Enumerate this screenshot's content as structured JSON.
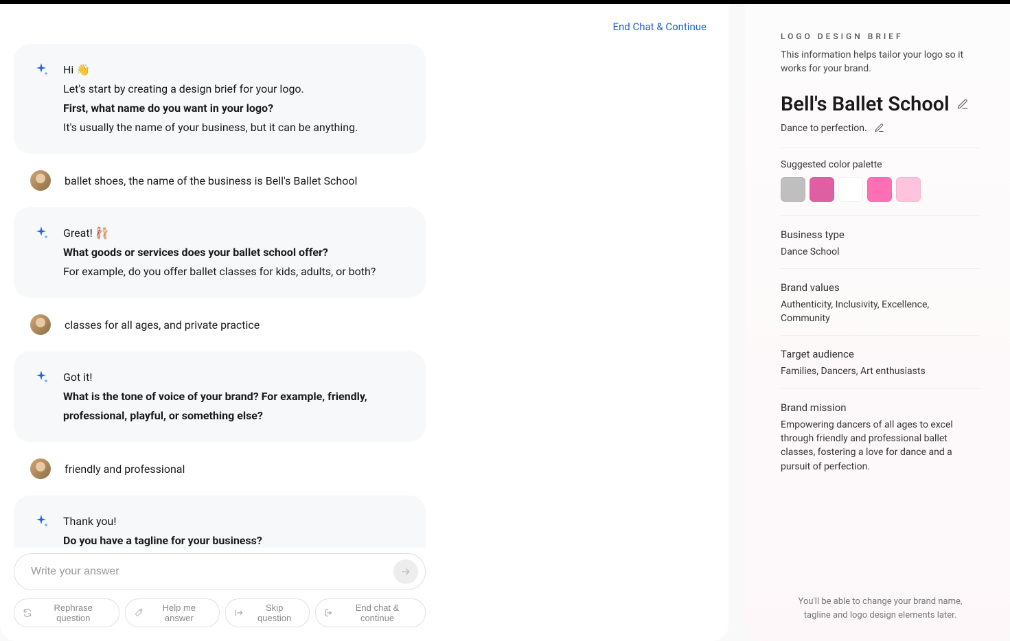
{
  "header": {
    "end_chat_label": "End Chat & Continue"
  },
  "chat": {
    "messages": [
      {
        "role": "bot",
        "lines": [
          {
            "text": "Hi 👋",
            "bold": false
          },
          {
            "text": "Let's start by creating a design brief for your logo.",
            "bold": false
          },
          {
            "text": "First, what name do you want in your logo?",
            "bold": true
          },
          {
            "text": "It's usually the name of your business, but it can be anything.",
            "bold": false
          }
        ]
      },
      {
        "role": "user",
        "text": "ballet shoes, the name of the business is Bell's Ballet School"
      },
      {
        "role": "bot",
        "lines": [
          {
            "text": "Great! 🩰",
            "bold": false
          },
          {
            "text": "What goods or services does your ballet school offer?",
            "bold": true
          },
          {
            "text": "For example, do you offer ballet classes for kids, adults, or both?",
            "bold": false
          }
        ]
      },
      {
        "role": "user",
        "text": "classes for all ages, and private practice"
      },
      {
        "role": "bot",
        "lines": [
          {
            "text": "Got it!",
            "bold": false
          },
          {
            "text": "What is the tone of voice of your brand? For example, friendly, professional, playful, or something else?",
            "bold": true
          }
        ]
      },
      {
        "role": "user",
        "text": "friendly and professional"
      },
      {
        "role": "bot",
        "lines": [
          {
            "text": "Thank you!",
            "bold": false
          },
          {
            "text": "Do you have a tagline for your business?",
            "bold": true
          }
        ]
      }
    ],
    "input_placeholder": "Write your answer",
    "chips": {
      "rephrase": "Rephrase question",
      "help": "Help me answer",
      "skip": "Skip question",
      "end": "End chat & continue"
    }
  },
  "brief": {
    "heading": "LOGO DESIGN BRIEF",
    "description": "This information helps tailor your logo so it works for your brand.",
    "brand_name": "Bell's Ballet School",
    "tagline": "Dance to perfection.",
    "palette_label": "Suggested color palette",
    "palette": [
      "#BFBFBF",
      "#E05FA3",
      "#FFFFFF",
      "#FF6FB5",
      "#FFC3DE"
    ],
    "business_type_label": "Business type",
    "business_type": "Dance School",
    "brand_values_label": "Brand values",
    "brand_values": "Authenticity, Inclusivity, Excellence, Community",
    "target_audience_label": "Target audience",
    "target_audience": "Families, Dancers, Art enthusiasts",
    "brand_mission_label": "Brand mission",
    "brand_mission": "Empowering dancers of all ages to excel through friendly and professional ballet classes, fostering a love for dance and a pursuit of perfection.",
    "footer_note": "You'll be able to change your brand name, tagline and logo design elements later."
  }
}
